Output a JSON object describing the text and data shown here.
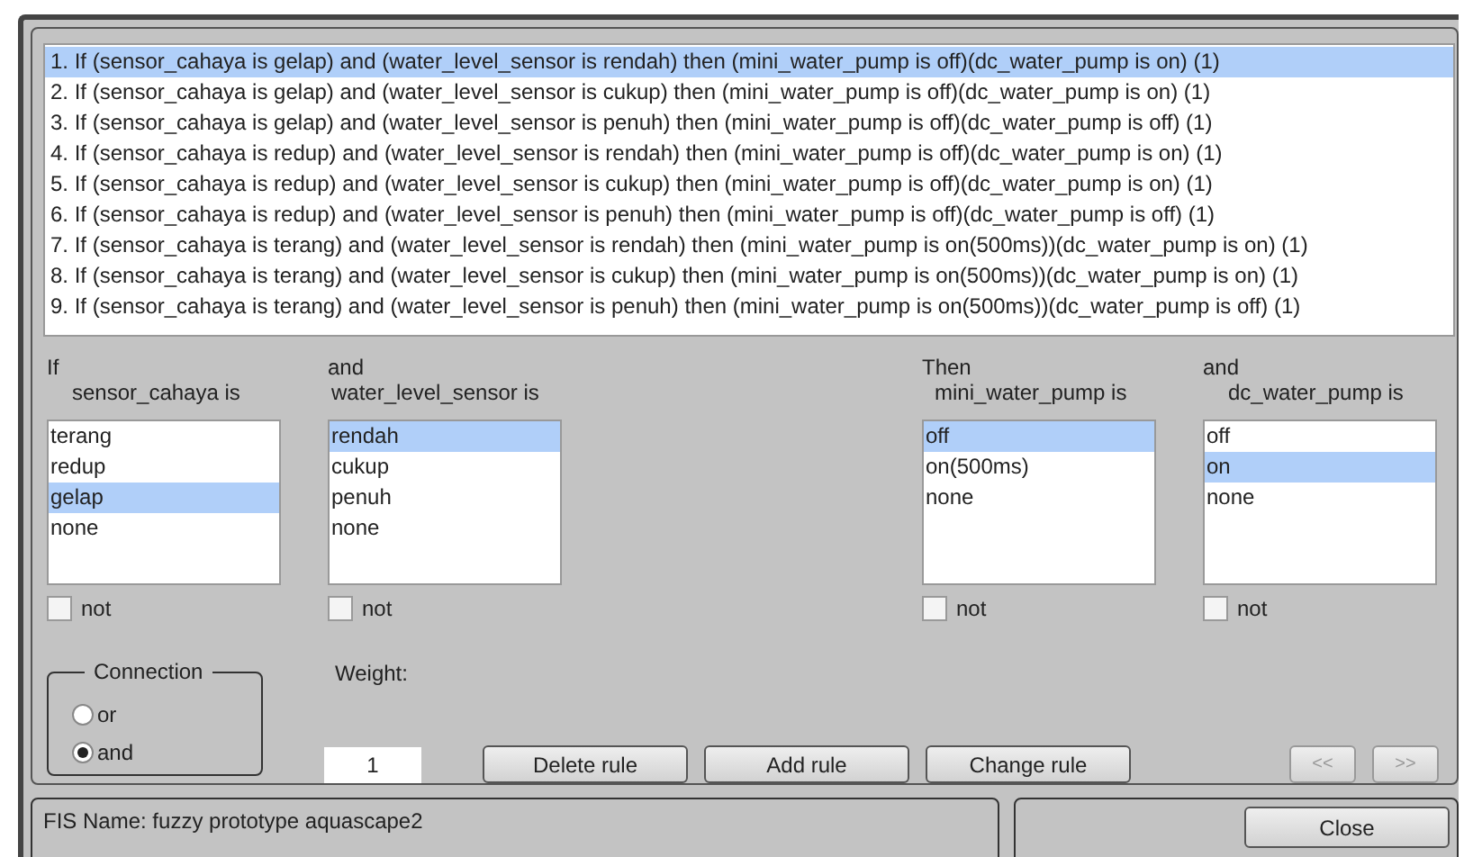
{
  "rules": [
    {
      "text": "1. If (sensor_cahaya is gelap) and (water_level_sensor is rendah) then (mini_water_pump is off)(dc_water_pump is on) (1)",
      "selected": true
    },
    {
      "text": "2. If (sensor_cahaya is gelap) and (water_level_sensor is cukup) then (mini_water_pump is off)(dc_water_pump is on) (1)",
      "selected": false
    },
    {
      "text": "3. If (sensor_cahaya is gelap) and (water_level_sensor is penuh) then (mini_water_pump is off)(dc_water_pump is off) (1)",
      "selected": false
    },
    {
      "text": "4. If (sensor_cahaya is redup) and (water_level_sensor is rendah) then (mini_water_pump is off)(dc_water_pump is on) (1)",
      "selected": false
    },
    {
      "text": "5. If (sensor_cahaya is redup) and (water_level_sensor is cukup) then (mini_water_pump is off)(dc_water_pump is on) (1)",
      "selected": false
    },
    {
      "text": "6. If (sensor_cahaya is redup) and (water_level_sensor is penuh) then (mini_water_pump is off)(dc_water_pump is off) (1)",
      "selected": false
    },
    {
      "text": "7. If (sensor_cahaya is terang) and (water_level_sensor is rendah) then (mini_water_pump is on(500ms))(dc_water_pump is on) (1)",
      "selected": false
    },
    {
      "text": "8. If (sensor_cahaya is terang) and (water_level_sensor is cukup) then (mini_water_pump is on(500ms))(dc_water_pump is on) (1)",
      "selected": false
    },
    {
      "text": "9. If (sensor_cahaya is terang) and (water_level_sensor is penuh) then (mini_water_pump is on(500ms))(dc_water_pump is off) (1)",
      "selected": false
    }
  ],
  "selectors": [
    {
      "connector": "If",
      "variable": "sensor_cahaya is",
      "options": [
        {
          "label": "terang",
          "selected": false
        },
        {
          "label": "redup",
          "selected": false
        },
        {
          "label": "gelap",
          "selected": true
        },
        {
          "label": "none",
          "selected": false
        }
      ],
      "not": {
        "label": "not",
        "checked": false
      }
    },
    {
      "connector": "and",
      "variable": "water_level_sensor is",
      "options": [
        {
          "label": "rendah",
          "selected": true
        },
        {
          "label": "cukup",
          "selected": false
        },
        {
          "label": "penuh",
          "selected": false
        },
        {
          "label": "none",
          "selected": false
        }
      ],
      "not": {
        "label": "not",
        "checked": false
      }
    },
    {
      "connector": "Then",
      "variable": "mini_water_pump is",
      "options": [
        {
          "label": "off",
          "selected": true
        },
        {
          "label": "on(500ms)",
          "selected": false
        },
        {
          "label": "none",
          "selected": false
        }
      ],
      "not": {
        "label": "not",
        "checked": false
      }
    },
    {
      "connector": "and",
      "variable": "dc_water_pump is",
      "options": [
        {
          "label": "off",
          "selected": false
        },
        {
          "label": "on",
          "selected": true
        },
        {
          "label": "none",
          "selected": false
        }
      ],
      "not": {
        "label": "not",
        "checked": false
      }
    }
  ],
  "connection": {
    "title": "Connection",
    "options": [
      {
        "label": "or",
        "selected": false
      },
      {
        "label": "and",
        "selected": true
      }
    ]
  },
  "weight": {
    "label": "Weight:",
    "value": "1"
  },
  "rule_buttons": [
    {
      "label": "Delete rule",
      "disabled": false
    },
    {
      "label": "Add rule",
      "disabled": false
    },
    {
      "label": "Change rule",
      "disabled": false
    }
  ],
  "nav_buttons": [
    {
      "label": "<<",
      "disabled": true
    },
    {
      "label": ">>",
      "disabled": true
    }
  ],
  "status": "FIS Name: fuzzy prototype aquascape2",
  "close_button": {
    "label": "Close"
  }
}
